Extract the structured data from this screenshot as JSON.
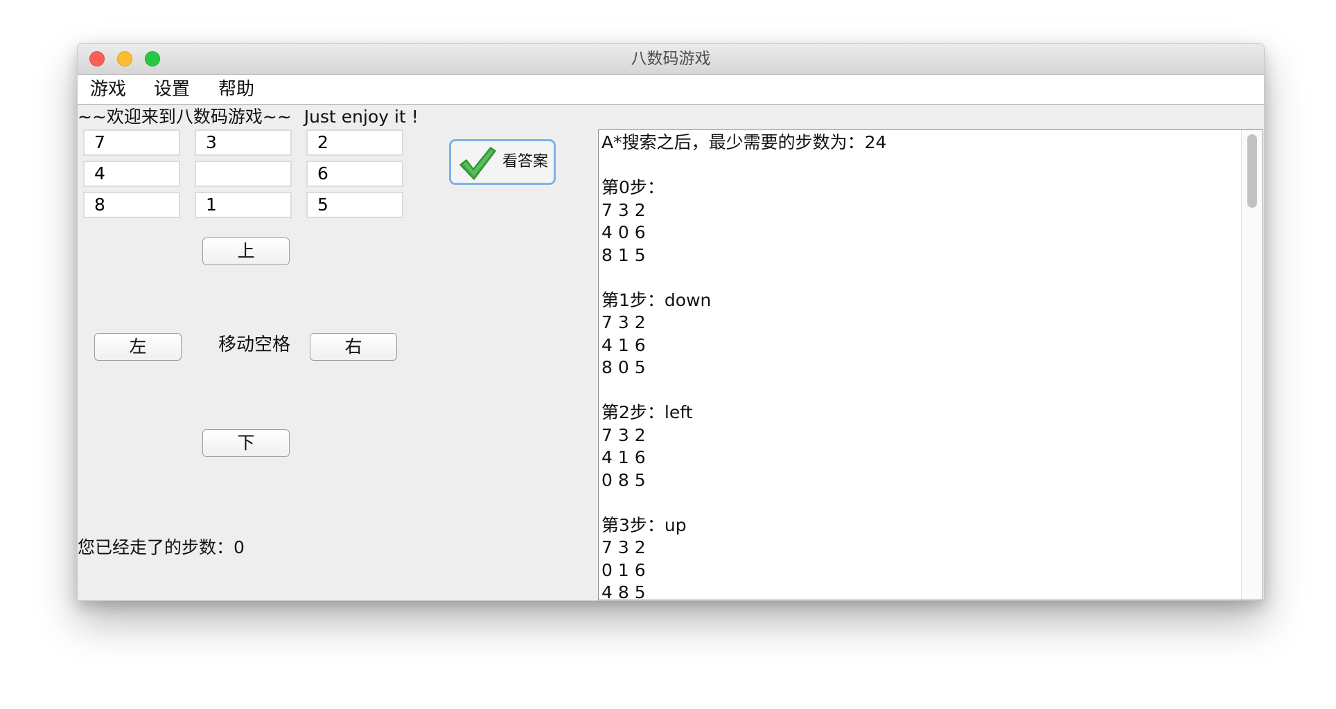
{
  "window": {
    "title": "八数码游戏"
  },
  "menu": {
    "items": [
      {
        "label": "游戏"
      },
      {
        "label": "设置"
      },
      {
        "label": "帮助"
      }
    ]
  },
  "header": {
    "welcome": "~~欢迎来到八数码游戏~~",
    "tagline": "Just enjoy it !"
  },
  "board": {
    "tiles": [
      "7",
      "3",
      "2",
      "4",
      "",
      "6",
      "8",
      "1",
      "5"
    ]
  },
  "controls": {
    "up": "上",
    "down": "下",
    "left": "左",
    "right": "右",
    "move_label": "移动空格"
  },
  "answer_button": {
    "label": "看答案",
    "icon": "checkmark-icon"
  },
  "status": {
    "steps_taken": "您已经走了的步数：0"
  },
  "output": {
    "text": "A*搜索之后，最少需要的步数为：24\n\n第0步：\n7 3 2\n4 0 6\n8 1 5\n\n第1步：down\n7 3 2\n4 1 6\n8 0 5\n\n第2步：left\n7 3 2\n4 1 6\n0 8 5\n\n第3步：up\n7 3 2\n0 1 6\n4 8 5"
  },
  "colors": {
    "accent_border": "#7db2e6",
    "check_green": "#3cab3c"
  }
}
